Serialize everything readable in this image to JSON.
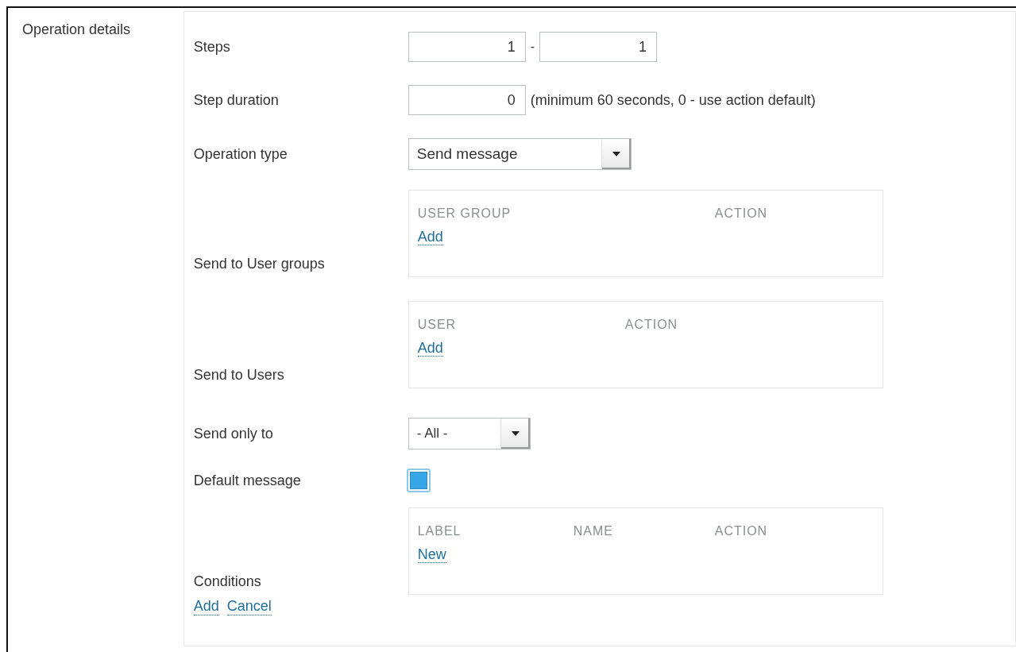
{
  "section_label": "Operation details",
  "fields": [
    {
      "kind": "range",
      "label": "Steps",
      "from": "1",
      "separator": "-",
      "to": "1"
    },
    {
      "kind": "number",
      "label": "Step duration",
      "value": "0",
      "hint": "(minimum 60 seconds, 0 - use action default)"
    },
    {
      "kind": "select",
      "label": "Operation type",
      "value": "Send message"
    },
    {
      "kind": "table",
      "label": "Send to User groups",
      "columns": [
        "USER GROUP",
        "ACTION"
      ],
      "link": "Add"
    },
    {
      "kind": "table",
      "label": "Send to Users",
      "columns": [
        "USER",
        "ACTION"
      ],
      "link": "Add"
    },
    {
      "kind": "select",
      "label": "Send only to",
      "value": "- All -"
    },
    {
      "kind": "checkbox",
      "label": "Default message",
      "checked": true
    },
    {
      "kind": "table",
      "label": "Conditions",
      "columns": [
        "LABEL",
        "NAME",
        "ACTION"
      ],
      "link": "New"
    }
  ],
  "actions": [
    "Add",
    "Cancel"
  ]
}
